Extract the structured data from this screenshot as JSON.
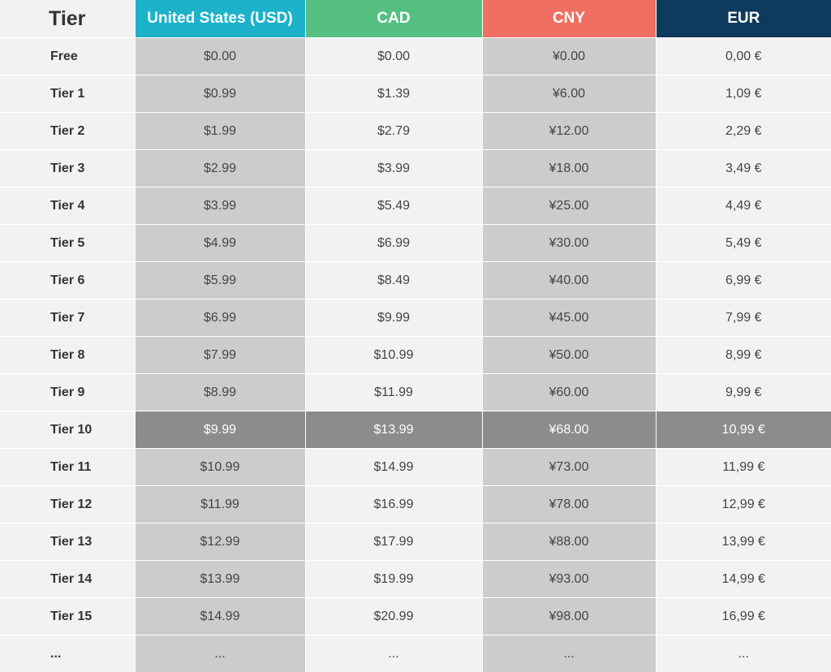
{
  "colors": {
    "usd_header": "#1cb2c9",
    "cad_header": "#55bf81",
    "cny_header": "#ef6f63",
    "eur_header": "#0d3a5d",
    "shaded_column": "#cccccc",
    "light_column": "#f2f2f2",
    "highlight_row": "#8c8c8c"
  },
  "headers": {
    "tier": "Tier",
    "usd": "United States (USD)",
    "cad": "CAD",
    "cny": "CNY",
    "eur": "EUR"
  },
  "highlighted_tier": "Tier 10",
  "rows": [
    {
      "tier": "Free",
      "usd": "$0.00",
      "cad": "$0.00",
      "cny": "¥0.00",
      "eur": "0,00 €"
    },
    {
      "tier": "Tier 1",
      "usd": "$0.99",
      "cad": "$1.39",
      "cny": "¥6.00",
      "eur": "1,09 €"
    },
    {
      "tier": "Tier 2",
      "usd": "$1.99",
      "cad": "$2.79",
      "cny": "¥12.00",
      "eur": "2,29 €"
    },
    {
      "tier": "Tier 3",
      "usd": "$2.99",
      "cad": "$3.99",
      "cny": "¥18.00",
      "eur": "3,49 €"
    },
    {
      "tier": "Tier 4",
      "usd": "$3.99",
      "cad": "$5.49",
      "cny": "¥25.00",
      "eur": "4,49 €"
    },
    {
      "tier": "Tier 5",
      "usd": "$4.99",
      "cad": "$6.99",
      "cny": "¥30.00",
      "eur": "5,49 €"
    },
    {
      "tier": "Tier 6",
      "usd": "$5.99",
      "cad": "$8.49",
      "cny": "¥40.00",
      "eur": "6,99 €"
    },
    {
      "tier": "Tier 7",
      "usd": "$6.99",
      "cad": "$9.99",
      "cny": "¥45.00",
      "eur": "7,99 €"
    },
    {
      "tier": "Tier 8",
      "usd": "$7.99",
      "cad": "$10.99",
      "cny": "¥50.00",
      "eur": "8,99 €"
    },
    {
      "tier": "Tier 9",
      "usd": "$8.99",
      "cad": "$11.99",
      "cny": "¥60.00",
      "eur": "9,99 €"
    },
    {
      "tier": "Tier 10",
      "usd": "$9.99",
      "cad": "$13.99",
      "cny": "¥68.00",
      "eur": "10,99 €"
    },
    {
      "tier": "Tier 11",
      "usd": "$10.99",
      "cad": "$14.99",
      "cny": "¥73.00",
      "eur": "11,99 €"
    },
    {
      "tier": "Tier 12",
      "usd": "$11.99",
      "cad": "$16.99",
      "cny": "¥78.00",
      "eur": "12,99 €"
    },
    {
      "tier": "Tier 13",
      "usd": "$12.99",
      "cad": "$17.99",
      "cny": "¥88.00",
      "eur": "13,99 €"
    },
    {
      "tier": "Tier 14",
      "usd": "$13.99",
      "cad": "$19.99",
      "cny": "¥93.00",
      "eur": "14,99 €"
    },
    {
      "tier": "Tier 15",
      "usd": "$14.99",
      "cad": "$20.99",
      "cny": "¥98.00",
      "eur": "16,99 €"
    },
    {
      "tier": "...",
      "usd": "...",
      "cad": "...",
      "cny": "...",
      "eur": "..."
    }
  ]
}
